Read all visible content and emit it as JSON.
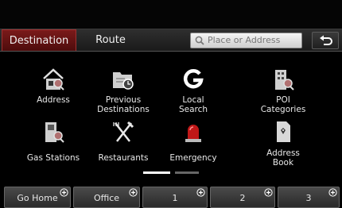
{
  "tabs": {
    "destination": "Destination",
    "route": "Route"
  },
  "search": {
    "placeholder": "Place or Address",
    "icon": "search-icon"
  },
  "back": {
    "icon": "back-arrow-icon"
  },
  "grid": [
    {
      "label": "Address",
      "icon": "house-search-icon"
    },
    {
      "label": "Previous\nDestinations",
      "icon": "folder-clock-icon"
    },
    {
      "label": "Local\nSearch",
      "icon": "google-g-icon"
    },
    {
      "label": "POI\nCategories",
      "icon": "building-search-icon"
    },
    {
      "label": "Gas Stations",
      "icon": "fuel-pump-icon"
    },
    {
      "label": "Restaurants",
      "icon": "utensils-icon"
    },
    {
      "label": "Emergency",
      "icon": "siren-icon"
    },
    {
      "label": "Address\nBook",
      "icon": "address-book-icon"
    }
  ],
  "page_indicator": {
    "current": 1,
    "total": 2
  },
  "favorites": [
    {
      "label": "Go Home"
    },
    {
      "label": "Office"
    },
    {
      "label": "1"
    },
    {
      "label": "2"
    },
    {
      "label": "3"
    }
  ],
  "colors": {
    "active_tab": "#6a1515",
    "background": "#000000"
  }
}
